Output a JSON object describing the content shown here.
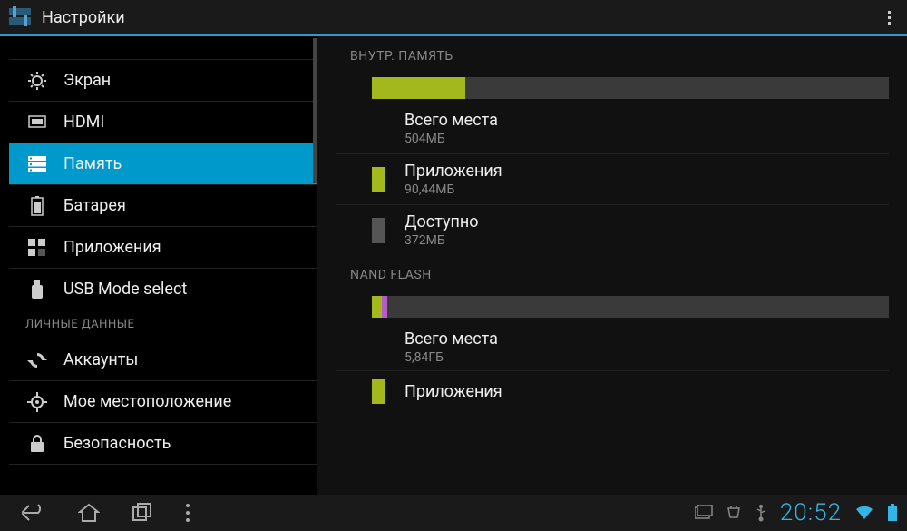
{
  "header": {
    "title": "Настройки"
  },
  "sidebar": {
    "items": [
      {
        "label": "Экран",
        "icon": "display-icon"
      },
      {
        "label": "HDMI",
        "icon": "hdmi-icon"
      },
      {
        "label": "Память",
        "icon": "storage-icon",
        "selected": true
      },
      {
        "label": "Батарея",
        "icon": "battery-icon"
      },
      {
        "label": "Приложения",
        "icon": "apps-icon"
      },
      {
        "label": "USB Mode select",
        "icon": "usb-icon"
      }
    ],
    "section_personal": "ЛИЧНЫЕ ДАННЫЕ",
    "items2": [
      {
        "label": "Аккаунты",
        "icon": "sync-icon"
      },
      {
        "label": "Мое местоположение",
        "icon": "location-icon"
      },
      {
        "label": "Безопасность",
        "icon": "lock-icon"
      }
    ]
  },
  "storage": {
    "section_internal": "ВНУТР. ПАМЯТЬ",
    "internal": {
      "total": {
        "label": "Всего места",
        "value": "504МБ"
      },
      "apps": {
        "label": "Приложения",
        "value": "90,44МБ",
        "color": "#a3b81d"
      },
      "available": {
        "label": "Доступно",
        "value": "372МБ",
        "color": "#555"
      },
      "bar_segments": [
        {
          "color": "#a3b81d",
          "width": "18%"
        }
      ]
    },
    "section_nand": "NAND FLASH",
    "nand": {
      "total": {
        "label": "Всего места",
        "value": "5,84ГБ"
      },
      "apps_label": "Приложения",
      "bar_segments": [
        {
          "color": "#a3b81d",
          "width": "2%"
        },
        {
          "color": "#b35fc4",
          "width": "1%"
        }
      ]
    }
  },
  "status": {
    "time": "20:52"
  }
}
